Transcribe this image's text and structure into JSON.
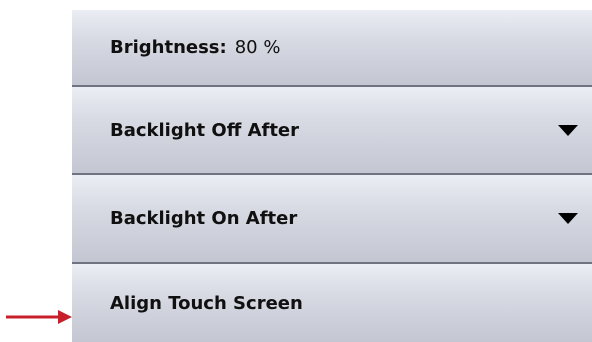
{
  "settings": {
    "brightness_label": "Brightness:",
    "brightness_value": "80 %",
    "backlight_off_label": "Backlight Off After",
    "backlight_on_label": "Backlight On After",
    "align_touch_label": "Align Touch Screen"
  },
  "annotation": {
    "arrow_color": "#c8202a",
    "arrow_target": "Align Touch Screen"
  },
  "icons": {
    "dropdown": "caret-down-icon",
    "pointer": "arrow-right-icon"
  }
}
